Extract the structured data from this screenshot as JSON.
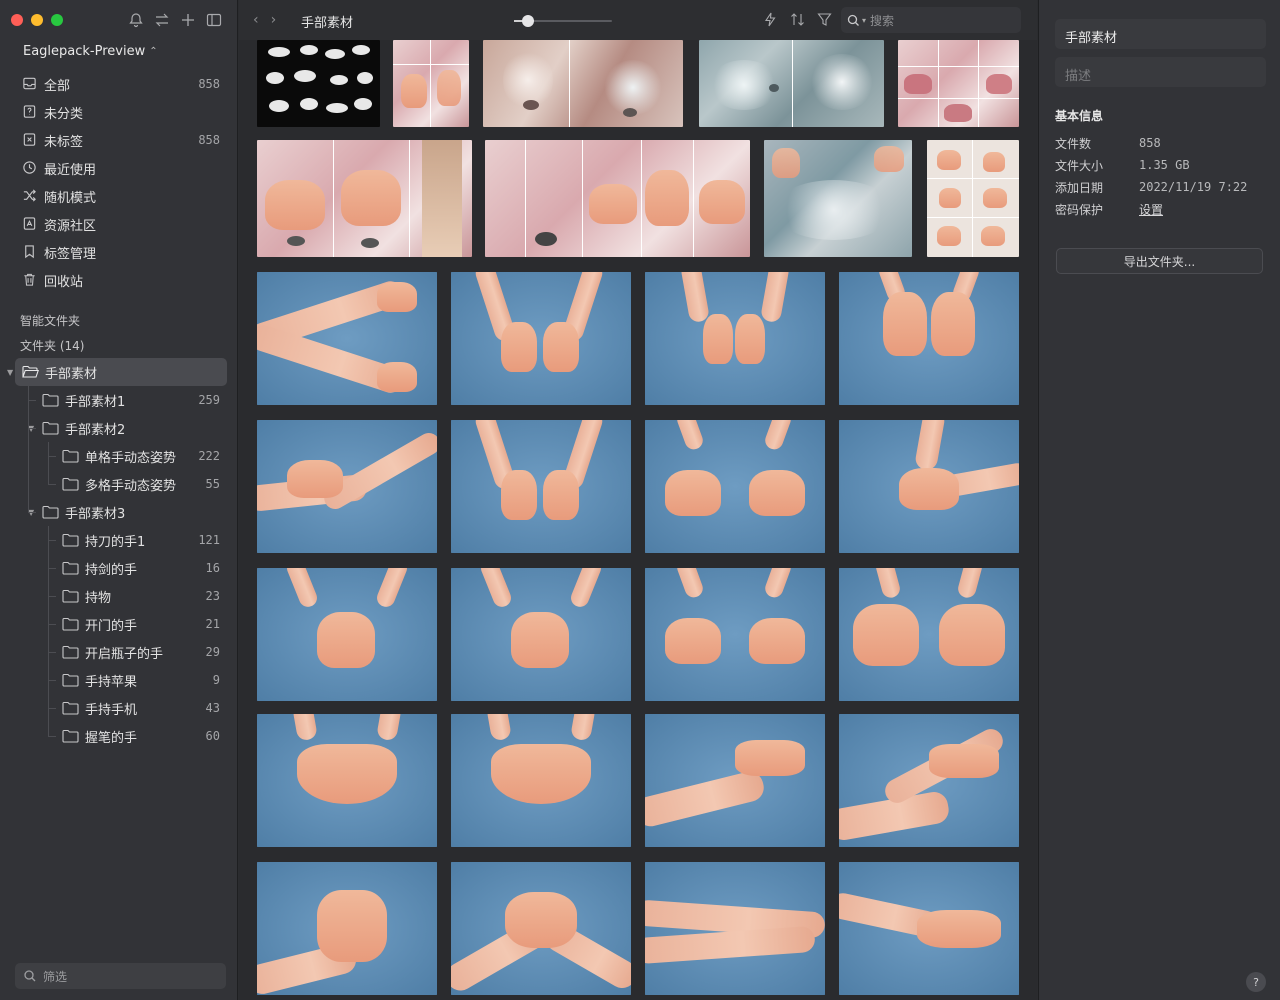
{
  "sidebar": {
    "library_name": "Eaglepack-Preview",
    "nav": [
      {
        "label": "全部",
        "count": "858",
        "icon": "inbox-icon"
      },
      {
        "label": "未分类",
        "count": "",
        "icon": "unsorted-icon"
      },
      {
        "label": "未标签",
        "count": "858",
        "icon": "untagged-icon"
      },
      {
        "label": "最近使用",
        "count": "",
        "icon": "clock-icon"
      },
      {
        "label": "随机模式",
        "count": "",
        "icon": "shuffle-icon"
      },
      {
        "label": "资源社区",
        "count": "",
        "icon": "community-icon"
      },
      {
        "label": "标签管理",
        "count": "",
        "icon": "tag-icon"
      },
      {
        "label": "回收站",
        "count": "",
        "icon": "trash-icon"
      }
    ],
    "smart_folders_title": "智能文件夹",
    "folders_title": "文件夹 (14)",
    "folders": [
      {
        "label": "手部素材",
        "count": "",
        "level": 0,
        "caret": true,
        "selected": true
      },
      {
        "label": "手部素材1",
        "count": "259",
        "level": 1,
        "caret": false
      },
      {
        "label": "手部素材2",
        "count": "",
        "level": 1,
        "caret": true
      },
      {
        "label": "单格手动态姿势",
        "count": "222",
        "level": 2,
        "caret": false
      },
      {
        "label": "多格手动态姿势",
        "count": "55",
        "level": 2,
        "caret": false
      },
      {
        "label": "手部素材3",
        "count": "",
        "level": 1,
        "caret": true
      },
      {
        "label": "持刀的手1",
        "count": "121",
        "level": 2,
        "caret": false
      },
      {
        "label": "持剑的手",
        "count": "16",
        "level": 2,
        "caret": false
      },
      {
        "label": "持物",
        "count": "23",
        "level": 2,
        "caret": false
      },
      {
        "label": "开门的手",
        "count": "21",
        "level": 2,
        "caret": false
      },
      {
        "label": "开启瓶子的手",
        "count": "29",
        "level": 2,
        "caret": false
      },
      {
        "label": "手持苹果",
        "count": "9",
        "level": 2,
        "caret": false
      },
      {
        "label": "手持手机",
        "count": "43",
        "level": 2,
        "caret": false
      },
      {
        "label": "握笔的手",
        "count": "60",
        "level": 2,
        "caret": false
      }
    ],
    "filter_placeholder": "筛选"
  },
  "toolbar": {
    "title": "手部素材",
    "search_placeholder": "搜索",
    "thumb_size": 0.14
  },
  "inspector": {
    "name": "手部素材",
    "desc_placeholder": "描述",
    "section_title": "基本信息",
    "rows": [
      {
        "k": "文件数",
        "v": "858"
      },
      {
        "k": "文件大小",
        "v": "1.35 GB"
      },
      {
        "k": "添加日期",
        "v": "2022/11/19 7:22"
      },
      {
        "k": "密码保护",
        "v": "设置"
      }
    ],
    "export_label": "导出文件夹...",
    "help_label": "?"
  }
}
